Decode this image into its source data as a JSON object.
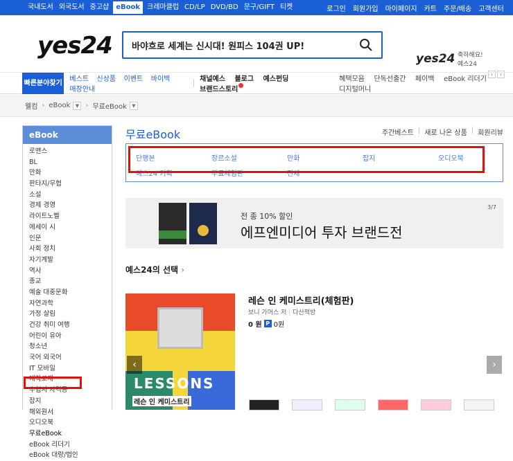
{
  "topnav": {
    "left": [
      "국내도서",
      "외국도서",
      "중고샵",
      "eBook",
      "크레마클럽",
      "CD/LP",
      "DVD/BD",
      "문구/GIFT",
      "티켓"
    ],
    "active": "eBook",
    "right": [
      "로그인",
      "회원가입",
      "마이페이지",
      "카트",
      "주문/배송",
      "고객센터"
    ]
  },
  "header": {
    "logo": "yes24",
    "search_value": "바야흐로 세계는 신시대! 원피스 104권 UP!",
    "promo_logo": "yes24",
    "promo_line1": "축하해요!",
    "promo_line2": "예스24"
  },
  "catnav": {
    "quick": "빠른분야찾기",
    "blue": [
      "베스트",
      "신상품",
      "이벤트",
      "바이백",
      "매장안내"
    ],
    "dark": [
      "채널예스",
      "블로그",
      "예스펀딩",
      "브랜드스토리"
    ],
    "right": [
      "혜택모음",
      "단독선출간",
      "페이백",
      "eBook 리더기",
      "디지털머니"
    ]
  },
  "breadcrumb": {
    "home": "웰컴",
    "level1": "eBook",
    "level2": "무료eBook"
  },
  "sidebar": {
    "title": "eBook",
    "items": [
      "로맨스",
      "BL",
      "만화",
      "판타지/무협",
      "소설",
      "경제 경영",
      "라이트노벨",
      "에세이 시",
      "인문",
      "사회 정치",
      "자기계발",
      "역사",
      "종교",
      "예술 대중문화",
      "자연과학",
      "가정 살림",
      "건강 취미 여행",
      "어린이 유아",
      "청소년",
      "국어 외국어",
      "IT 모바일",
      "대학교재",
      "수험서 자격증",
      "잡지",
      "해외원서",
      "오디오북",
      "무료eBook",
      "eBook 리더기",
      "eBook 대량/법인"
    ]
  },
  "main": {
    "title": "무료eBook",
    "sort": [
      "주간베스트",
      "새로 나온 상품",
      "회원리뷰"
    ],
    "subcats": [
      "단행본",
      "장르소설",
      "만화",
      "잡지",
      "오디오북",
      "예스24 기획",
      "무료체험판",
      "전체"
    ],
    "banner": {
      "line1": "전 종 10% 할인",
      "line2": "에프엔미디어 투자 브랜드전",
      "counter": "3/7"
    },
    "section_title": "예스24의 선택",
    "book": {
      "title": "레슨 인 케미스트리(체험판)",
      "author": "보니 가머스 저",
      "publisher": "다산책방",
      "price": "0 원",
      "point": "0원",
      "cover_title": "레슨 인 케미스트리",
      "cover_word": "LESSONS"
    }
  }
}
